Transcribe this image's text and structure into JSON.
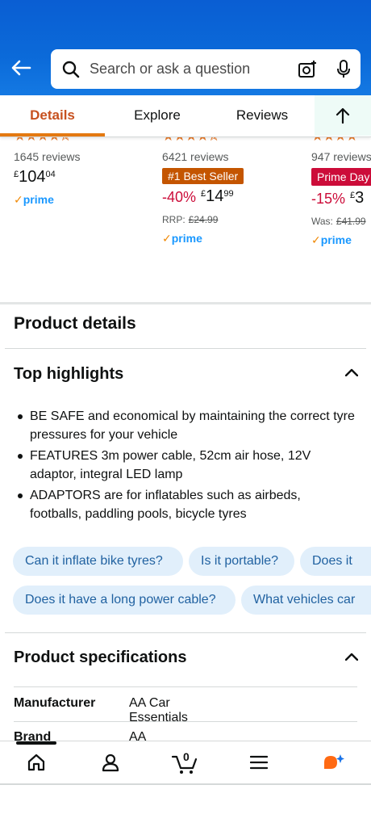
{
  "search": {
    "placeholder": "Search or ask a question"
  },
  "tabs": [
    {
      "label": "Details",
      "active": true
    },
    {
      "label": "Explore",
      "active": false
    },
    {
      "label": "Reviews",
      "active": false
    }
  ],
  "carousel": [
    {
      "reviews": "1645 reviews",
      "currency": "£",
      "price_main": "104",
      "price_frac": "04",
      "prime": "prime"
    },
    {
      "reviews": "6421 reviews",
      "badge": "#1 Best Seller",
      "discount": "-40%",
      "currency": "£",
      "price_main": "14",
      "price_frac": "99",
      "rrp_label": "RRP:",
      "rrp_value": "£24.99",
      "prime": "prime"
    },
    {
      "reviews": "947 reviews",
      "badge": "Prime Day Deal",
      "discount": "-15%",
      "currency": "£",
      "price_main": "3",
      "was_label": "Was:",
      "was_value": "£41.99",
      "prime": "prime"
    }
  ],
  "product_details": {
    "title": "Product details"
  },
  "top_highlights": {
    "title": "Top highlights",
    "bullets": [
      "BE SAFE and economical by maintaining the correct tyre pressures for your vehicle",
      "FEATURES 3m power cable, 52cm air hose, 12V adaptor, integral LED lamp",
      "ADAPTORS are for inflatables such as airbeds, footballs, paddling pools, bicycle tyres"
    ]
  },
  "questions": [
    "Can it inflate bike tyres?",
    "Is it portable?",
    "Does it",
    "Does it have a long power cable?",
    "What vehicles car"
  ],
  "specifications": {
    "title": "Product specifications",
    "rows": [
      {
        "key": "Manufacturer",
        "value": "AA Car Essentials"
      },
      {
        "key": "Brand",
        "value": "AA"
      }
    ]
  },
  "cart": {
    "count": "0"
  },
  "colors": {
    "brand_blue": "#0b6ad9",
    "accent_orange": "#e47911",
    "deal_red": "#cc0c39",
    "best_seller": "#c45500",
    "chip_bg": "#e1effb"
  }
}
